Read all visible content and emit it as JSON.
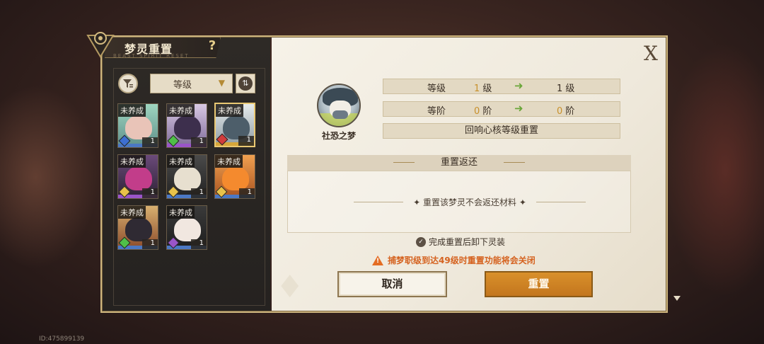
{
  "window": {
    "title": "梦灵重置",
    "subtitle": "BEAST SPIRIT RESET"
  },
  "filter": {
    "sort_value": "等级"
  },
  "cards": [
    {
      "tag": "未养成",
      "level": "1"
    },
    {
      "tag": "未养成",
      "level": "1"
    },
    {
      "tag": "未养成",
      "level": "1"
    },
    {
      "tag": "未养成",
      "level": "1"
    },
    {
      "tag": "未养成",
      "level": "1"
    },
    {
      "tag": "未养成",
      "level": "1"
    },
    {
      "tag": "未养成",
      "level": "1"
    },
    {
      "tag": "未养成",
      "level": "1"
    }
  ],
  "character": {
    "name": "社恐之梦"
  },
  "stats": {
    "level": {
      "label": "等级",
      "from": "1",
      "from_unit": "级",
      "to": "1",
      "to_unit": "级"
    },
    "rank": {
      "label": "等阶",
      "from": "0",
      "from_unit": "阶",
      "to": "0",
      "to_unit": "阶"
    },
    "core": "回响心核等级重置"
  },
  "reset_return": {
    "title": "重置返还",
    "message": "重置该梦灵不会返还材料"
  },
  "checkbox": {
    "label": "完成重置后卸下灵装"
  },
  "warning": {
    "text": "捕梦职级到达49级时重置功能将会关闭"
  },
  "buttons": {
    "cancel": "取消",
    "reset": "重置"
  },
  "footer": {
    "id": "ID:475899139"
  }
}
